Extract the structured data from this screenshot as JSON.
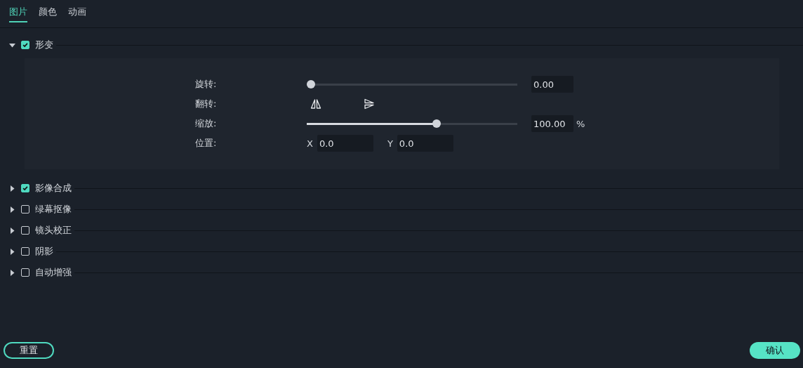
{
  "tabs": [
    {
      "label": "图片",
      "selected": true
    },
    {
      "label": "颜色",
      "selected": false
    },
    {
      "label": "动画",
      "selected": false
    }
  ],
  "sections": [
    {
      "title": "形变",
      "checked": true,
      "expanded": true,
      "rows": [
        {
          "kind": "slider",
          "label": "旋转:",
          "level": 0,
          "value": "0.00"
        },
        {
          "kind": "flip",
          "label": "翻转:"
        },
        {
          "kind": "slider",
          "label": "缩放:",
          "level": 0.62,
          "value": "100.00",
          "unit": "%"
        },
        {
          "kind": "position",
          "label": "位置:",
          "fields": [
            {
              "axis": "X",
              "value": "0.0"
            },
            {
              "axis": "Y",
              "value": "0.0"
            }
          ]
        }
      ]
    },
    {
      "title": "影像合成",
      "checked": true,
      "expanded": false
    },
    {
      "title": "绿幕抠像",
      "checked": false,
      "expanded": false
    },
    {
      "title": "镜头校正",
      "checked": false,
      "expanded": false
    },
    {
      "title": "阴影",
      "checked": false,
      "expanded": false
    },
    {
      "title": "自动增强",
      "checked": false,
      "expanded": false
    }
  ],
  "buttons": {
    "reset": "重置",
    "confirm": "确认"
  }
}
